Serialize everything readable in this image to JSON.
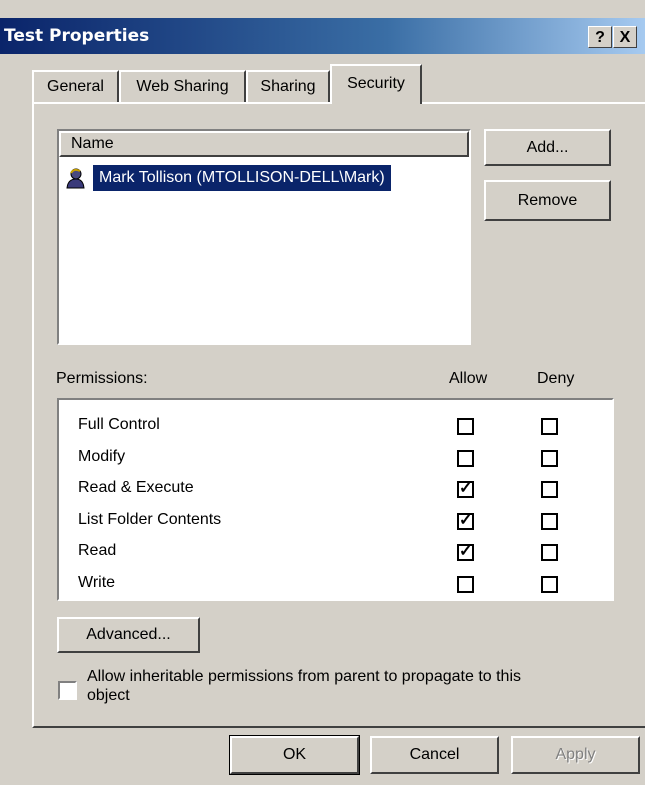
{
  "window": {
    "title": "Test Properties",
    "help_label": "?",
    "close_label": "X"
  },
  "tabs": [
    {
      "label": "General",
      "active": false
    },
    {
      "label": "Web Sharing",
      "active": false
    },
    {
      "label": "Sharing",
      "active": false
    },
    {
      "label": "Security",
      "active": true
    }
  ],
  "users": {
    "column_header": "Name",
    "items": [
      {
        "label": "Mark Tollison (MTOLLISON-DELL\\Mark)",
        "selected": true,
        "icon": "user-icon"
      }
    ],
    "add_label": "Add...",
    "remove_label": "Remove"
  },
  "permissions": {
    "header_label": "Permissions:",
    "allow_header": "Allow",
    "deny_header": "Deny",
    "rows": [
      {
        "name": "Full Control",
        "allow": false,
        "deny": false
      },
      {
        "name": "Modify",
        "allow": false,
        "deny": false
      },
      {
        "name": "Read & Execute",
        "allow": true,
        "deny": false
      },
      {
        "name": "List Folder Contents",
        "allow": true,
        "deny": false
      },
      {
        "name": "Read",
        "allow": true,
        "deny": false
      },
      {
        "name": "Write",
        "allow": false,
        "deny": false
      }
    ]
  },
  "advanced_label": "Advanced...",
  "inherit": {
    "checked": false,
    "label_line1": "Allow inheritable permissions from parent to propagate to this",
    "label_line2": "object"
  },
  "footer": {
    "ok_label": "OK",
    "cancel_label": "Cancel",
    "apply_label": "Apply"
  },
  "colors": {
    "selection": "#0a246a",
    "face": "#d4d0c8"
  }
}
